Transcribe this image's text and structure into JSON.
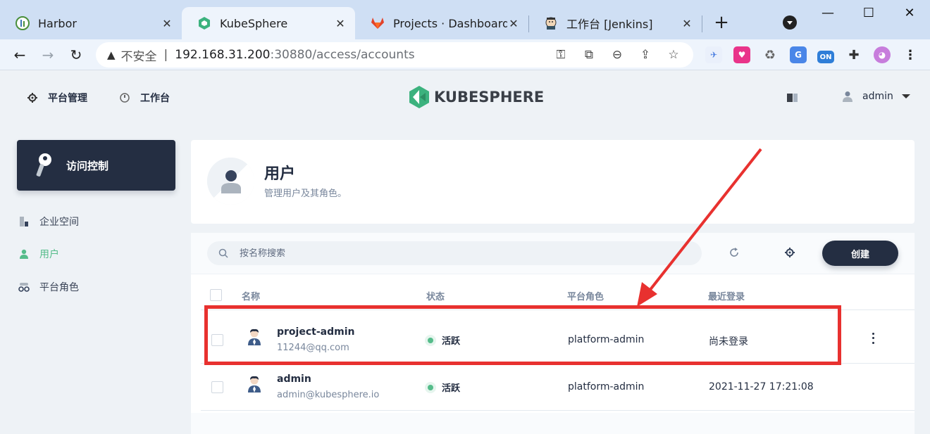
{
  "browser": {
    "tabs": [
      {
        "title": "Harbor",
        "favicon": "harbor-icon",
        "active": false
      },
      {
        "title": "KubeSphere",
        "favicon": "kubesphere-icon",
        "active": true
      },
      {
        "title": "Projects · Dashboard · G",
        "favicon": "gitlab-icon",
        "active": false
      },
      {
        "title": "工作台 [Jenkins]",
        "favicon": "jenkins-icon",
        "active": false
      }
    ],
    "new_tab": "+",
    "close_glyph": "✕",
    "window_controls": {
      "minimize": "—",
      "maximize": "☐",
      "close": "✕"
    },
    "omnibox": {
      "security_warning": "▲",
      "security_label": "不安全",
      "separator": "|",
      "url_host": "192.168.31.200",
      "url_rest": ":30880/access/accounts"
    },
    "extension_on_label": "ON"
  },
  "header": {
    "nav": [
      {
        "label": "平台管理",
        "icon": "gear-icon"
      },
      {
        "label": "工作台",
        "icon": "clock-icon"
      }
    ],
    "logo_text": "KUBESPHERE",
    "user": "admin"
  },
  "sidebar": {
    "card_title": "访问控制",
    "items": [
      {
        "label": "企业空间",
        "icon": "workspace-icon",
        "active": false
      },
      {
        "label": "用户",
        "icon": "user-icon",
        "active": true
      },
      {
        "label": "平台角色",
        "icon": "role-icon",
        "active": false
      }
    ]
  },
  "banner": {
    "title": "用户",
    "description": "管理用户及其角色。"
  },
  "toolbar": {
    "search_placeholder": "按名称搜索",
    "create_label": "创建"
  },
  "table": {
    "columns": [
      "名称",
      "状态",
      "平台角色",
      "最近登录"
    ],
    "rows": [
      {
        "name": "project-admin",
        "email": "11244@qq.com",
        "status": "活跃",
        "role": "platform-admin",
        "last_login": "尚未登录"
      },
      {
        "name": "admin",
        "email": "admin@kubesphere.io",
        "status": "活跃",
        "role": "platform-admin",
        "last_login": "2021-11-27 17:21:08"
      }
    ]
  },
  "colors": {
    "accent_green": "#55bc8a",
    "dark": "#242e42",
    "annotation_red": "#e8312f"
  }
}
